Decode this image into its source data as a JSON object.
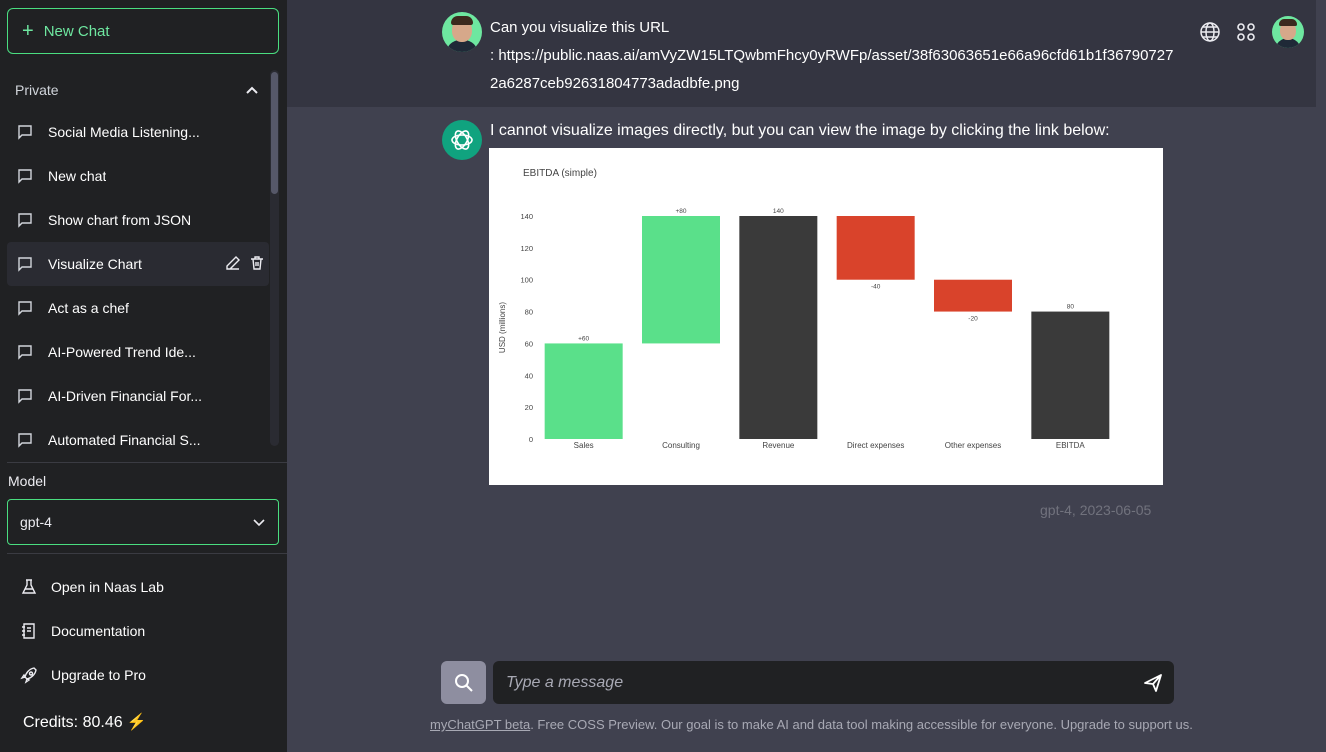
{
  "sidebar": {
    "new_chat_label": "New Chat",
    "section_title": "Private",
    "items": [
      {
        "label": "Social Media Listening..."
      },
      {
        "label": "New chat"
      },
      {
        "label": "Show chart from JSON"
      },
      {
        "label": "Visualize Chart"
      },
      {
        "label": "Act as a chef"
      },
      {
        "label": "AI-Powered Trend Ide..."
      },
      {
        "label": "AI-Driven Financial For..."
      },
      {
        "label": "Automated Financial S..."
      }
    ],
    "model_label": "Model",
    "model_value": "gpt-4",
    "links": [
      {
        "label": "Open in Naas Lab",
        "icon": "flask-icon"
      },
      {
        "label": "Documentation",
        "icon": "book-icon"
      },
      {
        "label": "Upgrade to Pro",
        "icon": "rocket-icon"
      }
    ],
    "credits": "Credits: 80.46"
  },
  "conversation": {
    "user_message_line1": "Can you visualize this URL",
    "user_message_url": ": https://public.naas.ai/amVyZW15LTQwbmFhcy0yRWFp/asset/38f63063651e66a96cfd61b1f367907272a6287ceb92631804773adadbfe.png",
    "assistant_message": "I cannot visualize images directly, but you can view the image by clicking the link below:",
    "meta": "gpt-4, 2023-06-05"
  },
  "input": {
    "placeholder": "Type a message"
  },
  "footer": {
    "link_text": "myChatGPT beta",
    "text": ". Free COSS Preview. Our goal is to make AI and data tool making accessible for everyone. Upgrade to support us."
  },
  "colors": {
    "accent": "#4ade80",
    "increase": "#5ae08a",
    "decrease": "#d9432b",
    "total": "#3a3a3a"
  },
  "chart_data": {
    "type": "bar",
    "subtype": "waterfall",
    "title": "EBITDA (simple)",
    "ylabel": "USD (millions)",
    "xlabel": "",
    "ylim": [
      0,
      140
    ],
    "yticks": [
      0,
      20,
      40,
      60,
      80,
      100,
      120,
      140
    ],
    "categories": [
      "Sales",
      "Consulting",
      "Revenue",
      "Direct expenses",
      "Other expenses",
      "EBITDA"
    ],
    "bars": [
      {
        "category": "Sales",
        "base": 0,
        "top": 60,
        "label": "+60",
        "kind": "increase"
      },
      {
        "category": "Consulting",
        "base": 60,
        "top": 140,
        "label": "+80",
        "kind": "increase"
      },
      {
        "category": "Revenue",
        "base": 0,
        "top": 140,
        "label": "140",
        "kind": "total"
      },
      {
        "category": "Direct expenses",
        "base": 100,
        "top": 140,
        "label": "-40",
        "kind": "decrease"
      },
      {
        "category": "Other expenses",
        "base": 80,
        "top": 100,
        "label": "-20",
        "kind": "decrease"
      },
      {
        "category": "EBITDA",
        "base": 0,
        "top": 80,
        "label": "80",
        "kind": "total"
      }
    ]
  }
}
